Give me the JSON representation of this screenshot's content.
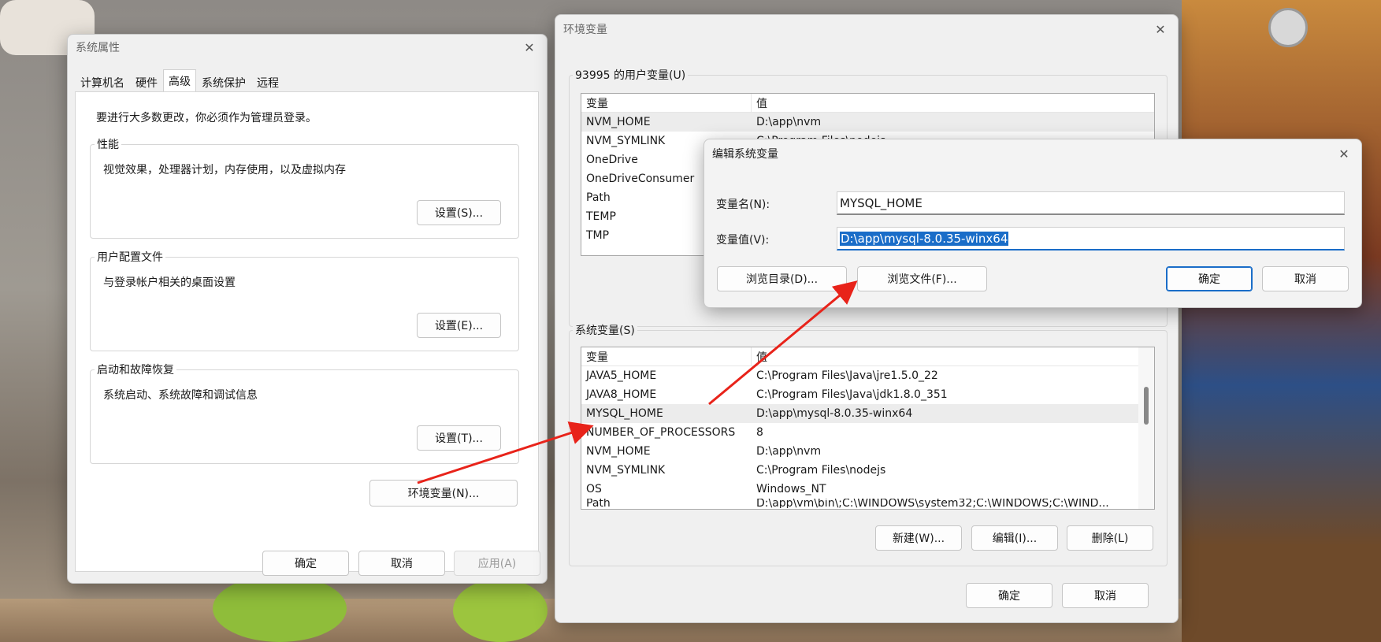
{
  "sysprops": {
    "title": "系统属性",
    "tabs": [
      "计算机名",
      "硬件",
      "高级",
      "系统保护",
      "远程"
    ],
    "admin_notice": "要进行大多数更改，你必须作为管理员登录。",
    "performance": {
      "title": "性能",
      "desc": "视觉效果，处理器计划，内存使用，以及虚拟内存",
      "button": "设置(S)..."
    },
    "user_profiles": {
      "title": "用户配置文件",
      "desc": "与登录帐户相关的桌面设置",
      "button": "设置(E)..."
    },
    "startup": {
      "title": "启动和故障恢复",
      "desc": "系统启动、系统故障和调试信息",
      "button": "设置(T)..."
    },
    "env_button": "环境变量(N)...",
    "ok": "确定",
    "cancel": "取消",
    "apply": "应用(A)"
  },
  "envvars": {
    "title": "环境变量",
    "user_group_label": "93995 的用户变量(U)",
    "col_var": "变量",
    "col_val": "值",
    "user_rows": [
      {
        "name": "NVM_HOME",
        "value": "D:\\app\\nvm"
      },
      {
        "name": "NVM_SYMLINK",
        "value": "C:\\Program Files\\nodejs"
      },
      {
        "name": "OneDrive",
        "value": ""
      },
      {
        "name": "OneDriveConsumer",
        "value": ""
      },
      {
        "name": "Path",
        "value": ""
      },
      {
        "name": "TEMP",
        "value": ""
      },
      {
        "name": "TMP",
        "value": ""
      }
    ],
    "system_group_label": "系统变量(S)",
    "system_rows": [
      {
        "name": "JAVA5_HOME",
        "value": "C:\\Program Files\\Java\\jre1.5.0_22"
      },
      {
        "name": "JAVA8_HOME",
        "value": "C:\\Program Files\\Java\\jdk1.8.0_351"
      },
      {
        "name": "MYSQL_HOME",
        "value": "D:\\app\\mysql-8.0.35-winx64"
      },
      {
        "name": "NUMBER_OF_PROCESSORS",
        "value": "8"
      },
      {
        "name": "NVM_HOME",
        "value": "D:\\app\\nvm"
      },
      {
        "name": "NVM_SYMLINK",
        "value": "C:\\Program Files\\nodejs"
      },
      {
        "name": "OS",
        "value": "Windows_NT"
      },
      {
        "name": "Path",
        "value": "D:\\app\\vm\\bin\\;C:\\WINDOWS\\system32;C:\\WINDOWS;C:\\WIND..."
      }
    ],
    "new_button": "新建(W)...",
    "edit_button": "编辑(I)...",
    "delete_button": "删除(L)",
    "ok": "确定",
    "cancel": "取消"
  },
  "editdlg": {
    "title": "编辑系统变量",
    "name_label": "变量名(N):",
    "value_label": "变量值(V):",
    "name_value": "MYSQL_HOME",
    "value_value": "D:\\app\\mysql-8.0.35-winx64",
    "browse_dir": "浏览目录(D)...",
    "browse_file": "浏览文件(F)...",
    "ok": "确定",
    "cancel": "取消"
  },
  "colors": {
    "accent": "#1a6dc8",
    "annotation_arrow": "#e8231a"
  }
}
